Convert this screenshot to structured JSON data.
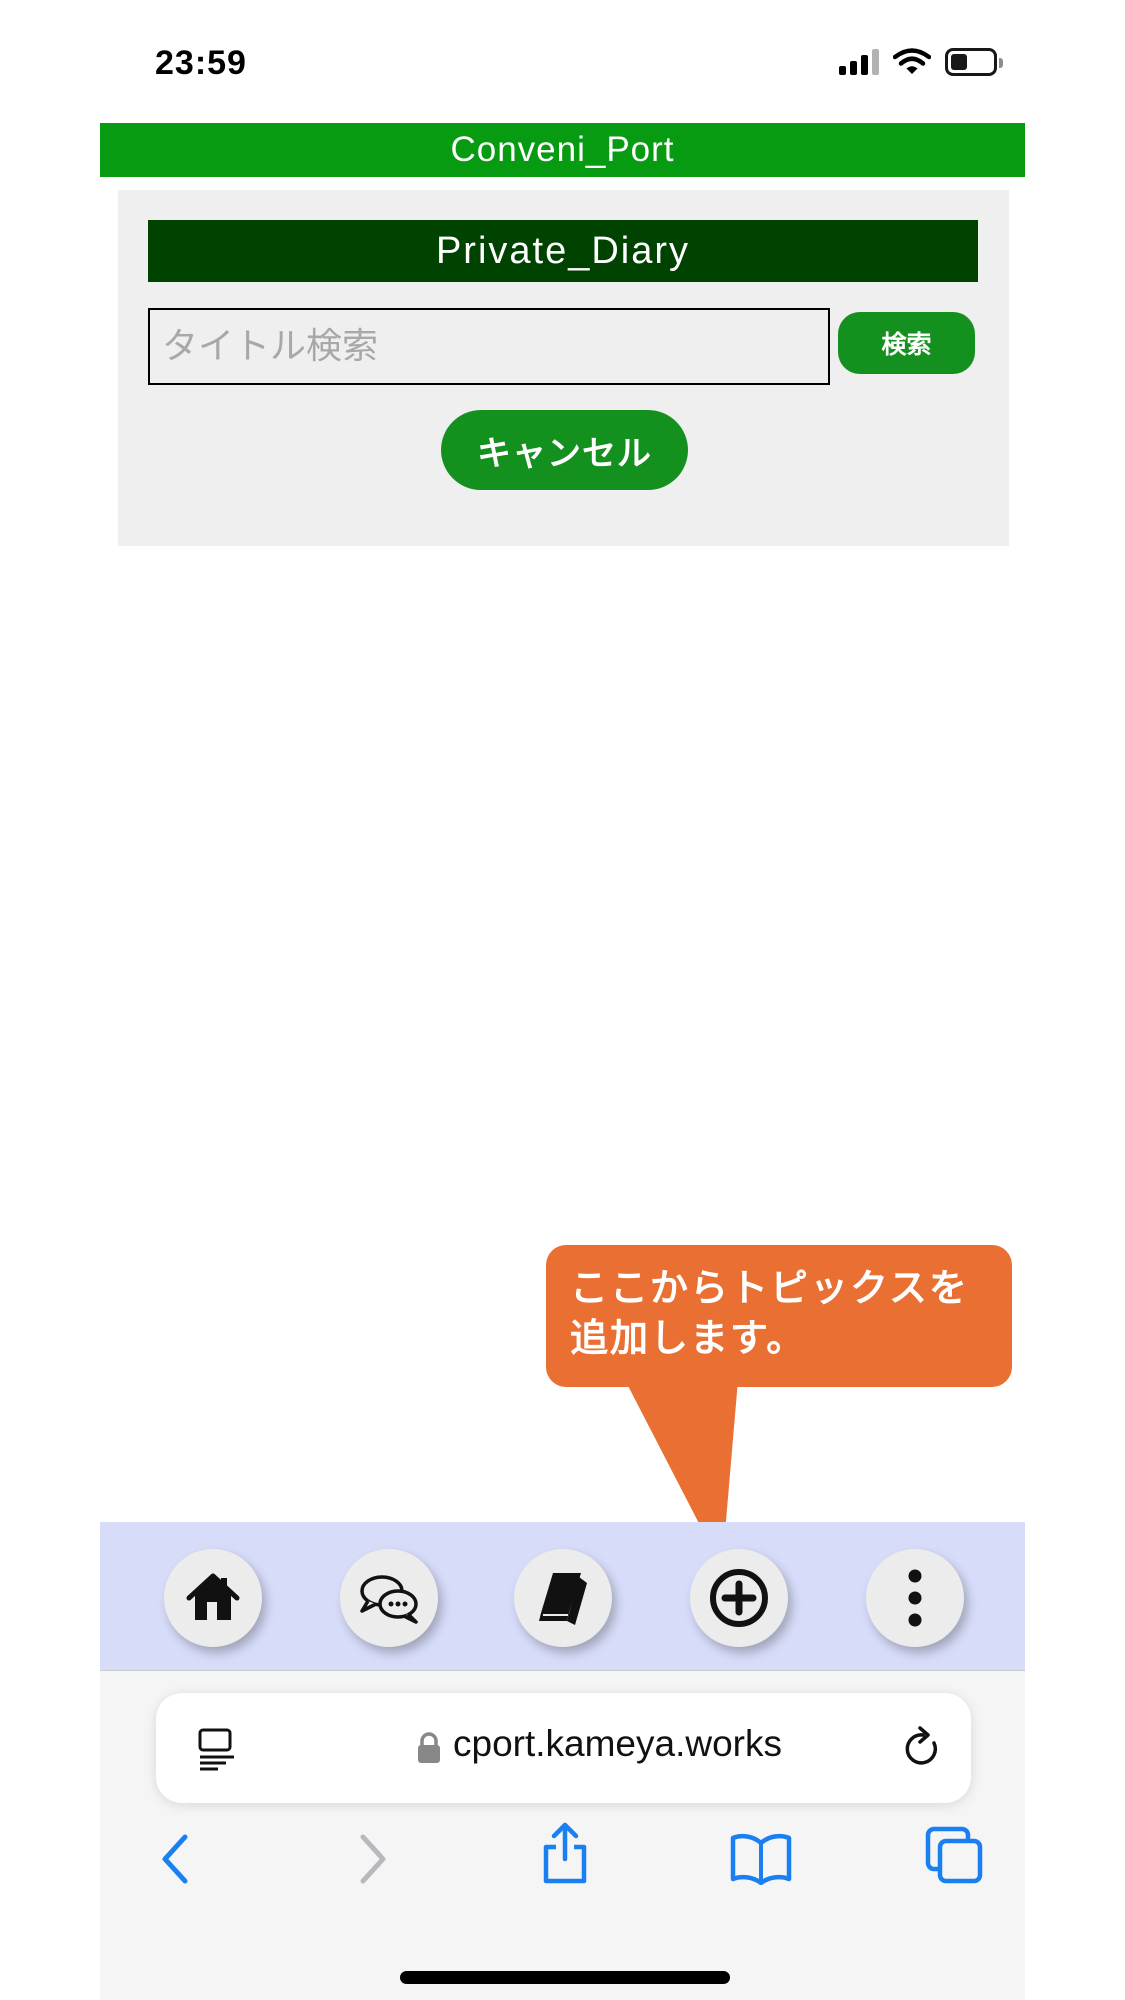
{
  "status_bar": {
    "time": "23:59",
    "icons": [
      "signal-icon",
      "wifi-icon",
      "battery-icon"
    ]
  },
  "app": {
    "title": "Conveni_Port",
    "brand_color": "#079b12"
  },
  "panel": {
    "title": "Private_Diary",
    "search_placeholder": "タイトル検索",
    "search_value": "",
    "search_button": "検索",
    "cancel_button": "キャンセル"
  },
  "callout": {
    "line1": "ここからトピックスを",
    "line2": "追加します。",
    "color": "#e97032"
  },
  "bottom_nav": {
    "items": [
      {
        "icon": "home-icon"
      },
      {
        "icon": "chat-icon"
      },
      {
        "icon": "book-icon"
      },
      {
        "icon": "add-circle-icon"
      },
      {
        "icon": "more-vertical-icon"
      }
    ],
    "background": "#d7dcf9"
  },
  "browser": {
    "url": "cport.kameya.works",
    "toolbar": [
      "back-icon",
      "forward-icon",
      "share-icon",
      "bookmarks-icon",
      "tabs-icon"
    ],
    "accent": "#1a7ff0"
  }
}
